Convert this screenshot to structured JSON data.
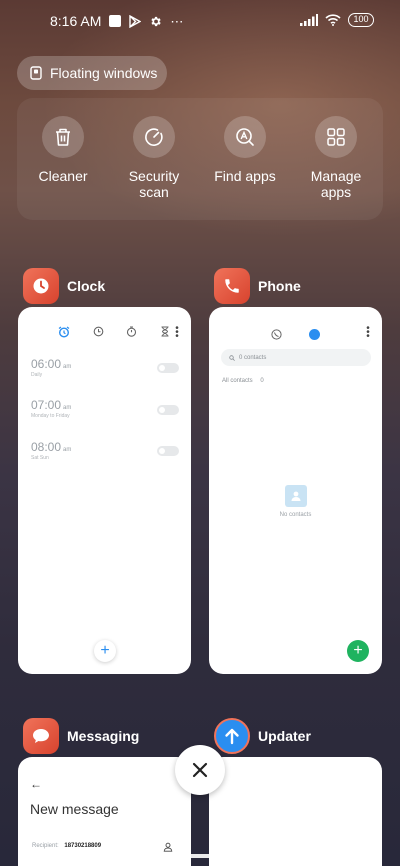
{
  "status_bar": {
    "time": "8:16 AM",
    "battery": "100",
    "icons": [
      "square-notification-icon",
      "play-store-icon",
      "gear-icon",
      "more-dots-icon",
      "signal-icon",
      "wifi-icon",
      "battery-icon"
    ]
  },
  "floating_windows": {
    "label": "Floating windows"
  },
  "tools": [
    {
      "label": "Cleaner",
      "icon": "trash-icon"
    },
    {
      "label": "Security\nscan",
      "icon": "security-scan-icon"
    },
    {
      "label": "Find apps",
      "icon": "find-apps-icon"
    },
    {
      "label": "Manage\napps",
      "icon": "grid-icon"
    }
  ],
  "apps": {
    "clock": {
      "name": "Clock",
      "accent": "#e8553c",
      "alarms": [
        {
          "time": "06:00",
          "ampm": "am",
          "sub": "Daily"
        },
        {
          "time": "07:00",
          "ampm": "am",
          "sub": "Monday to Friday"
        },
        {
          "time": "08:00",
          "ampm": "am",
          "sub": "Sat Sun"
        }
      ],
      "fab": "+"
    },
    "phone": {
      "name": "Phone",
      "accent": "#e8553c",
      "search_placeholder": "0 contacts",
      "all_contacts": "All contacts",
      "all_contacts_count": "0",
      "empty_text": "No contacts",
      "fab": "+",
      "fab_color": "#1fb35f"
    },
    "messaging": {
      "name": "Messaging",
      "title": "New message",
      "recipient_label": "Recipient:",
      "recipient_value": "18730218809"
    },
    "updater": {
      "name": "Updater",
      "accent": "#2a8ef0"
    }
  }
}
